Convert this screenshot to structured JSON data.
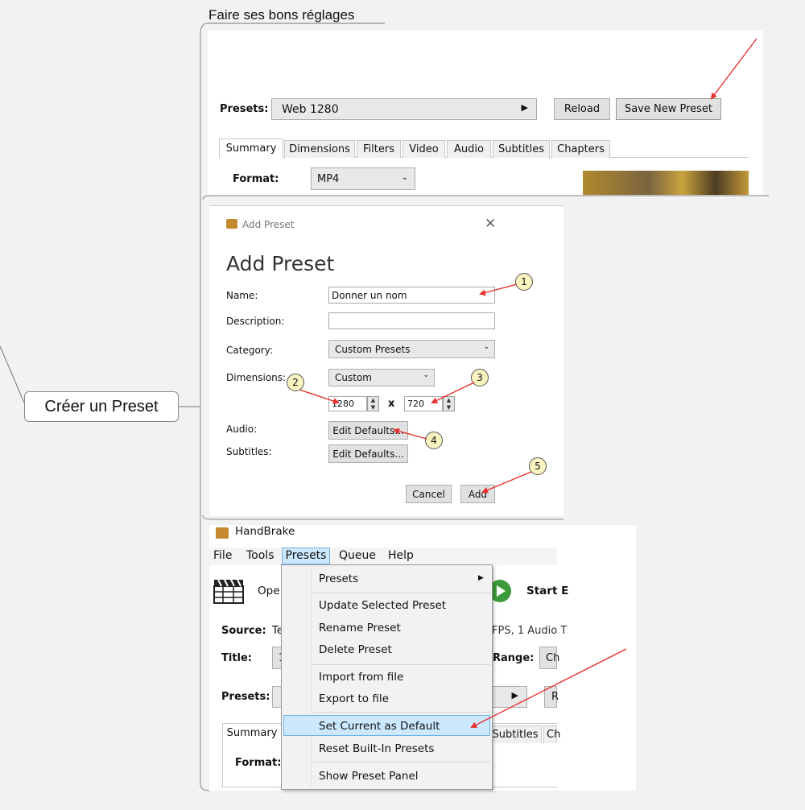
{
  "mindmap": {
    "section_title": "Faire ses bons réglages",
    "node_label": "Créer un Preset"
  },
  "top_panel": {
    "presets_label": "Presets:",
    "preset_value": "Web 1280",
    "reload_button": "Reload",
    "save_new_preset_button": "Save New Preset",
    "tabs": [
      "Summary",
      "Dimensions",
      "Filters",
      "Video",
      "Audio",
      "Subtitles",
      "Chapters"
    ],
    "format_label": "Format:",
    "format_value": "MP4"
  },
  "add_preset_dialog": {
    "window_title": "Add Preset",
    "heading": "Add Preset",
    "name_label": "Name:",
    "name_value": "Donner un nom",
    "description_label": "Description:",
    "description_value": "",
    "category_label": "Category:",
    "category_value": "Custom Presets",
    "dimensions_label": "Dimensions:",
    "dimensions_value": "Custom",
    "width": "1280",
    "times": "x",
    "height": "720",
    "audio_label": "Audio:",
    "subtitles_label": "Subtitles:",
    "edit_defaults_audio": "Edit Defaults...",
    "edit_defaults_subtitles": "Edit Defaults...",
    "cancel_button": "Cancel",
    "add_button": "Add",
    "callouts": [
      "1",
      "2",
      "3",
      "4",
      "5"
    ]
  },
  "handbrake_window": {
    "app_title": "HandBrake",
    "menu": [
      "File",
      "Tools",
      "Presets",
      "Queue",
      "Help"
    ],
    "open_label": "Ope",
    "start_label": "Start E",
    "source_label": "Source:",
    "source_value": "Te",
    "source_info": "FPS, 1 Audio T",
    "title_label": "Title:",
    "title_value": "1",
    "range_label": "Range:",
    "range_value": "Ch",
    "presets_label": "Presets:",
    "presets_right": "R",
    "tab_summary": "Summary",
    "tab_subtitles": "Subtitles",
    "tab_ch": "Ch",
    "format_label": "Format:"
  },
  "presets_menu": {
    "items": [
      "Presets",
      "Update Selected Preset",
      "Rename Preset",
      "Delete Preset",
      "Import from file",
      "Export to file",
      "Set Current as Default",
      "Reset Built-In Presets",
      "Show Preset Panel"
    ],
    "highlighted": "Set Current as Default"
  },
  "colors": {
    "arrow": "#e8312f",
    "menu_highlight": "#cce8ff",
    "callout_fill": "#f9f3c0"
  }
}
